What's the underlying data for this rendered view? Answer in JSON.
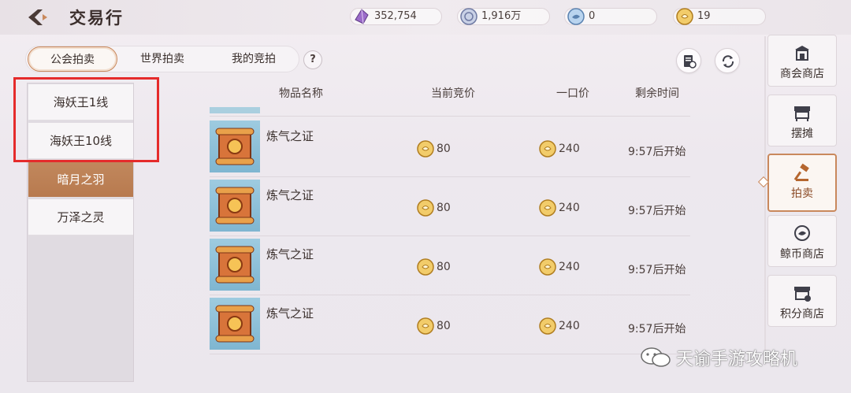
{
  "header": {
    "title": "交易行",
    "currencies": [
      {
        "icon": "purple-crystal-icon",
        "value": "352,754"
      },
      {
        "icon": "silver-coin-icon",
        "value": "1,916万"
      },
      {
        "icon": "whale-coin-icon",
        "value": "0"
      },
      {
        "icon": "gold-coin-icon",
        "value": "19"
      }
    ]
  },
  "tabs": [
    {
      "label": "公会拍卖",
      "active": true
    },
    {
      "label": "世界拍卖",
      "active": false
    },
    {
      "label": "我的竞拍",
      "active": false
    }
  ],
  "help_label": "?",
  "servers": [
    {
      "label": "海妖王1线",
      "active": false
    },
    {
      "label": "海妖王10线",
      "active": false
    },
    {
      "label": "暗月之羽",
      "active": true
    },
    {
      "label": "万泽之灵",
      "active": false
    }
  ],
  "columns": {
    "name": "物品名称",
    "bid": "当前竞价",
    "buyout": "一口价",
    "time": "剩余时间"
  },
  "items": [
    {
      "name": "炼气之证",
      "bid": "80",
      "buyout": "240",
      "time": "9:57后开始"
    },
    {
      "name": "炼气之证",
      "bid": "80",
      "buyout": "240",
      "time": "9:57后开始"
    },
    {
      "name": "炼气之证",
      "bid": "80",
      "buyout": "240",
      "time": "9:57后开始"
    },
    {
      "name": "炼气之证",
      "bid": "80",
      "buyout": "240",
      "time": "9:57后开始"
    }
  ],
  "sidebar": [
    {
      "label": "商会商店",
      "icon": "shop-icon",
      "active": false
    },
    {
      "label": "摆摊",
      "icon": "stall-icon",
      "active": false
    },
    {
      "label": "拍卖",
      "icon": "auction-hammer-icon",
      "active": true
    },
    {
      "label": "鲸币商店",
      "icon": "whale-coin-icon",
      "active": false
    },
    {
      "label": "积分商店",
      "icon": "points-shop-icon",
      "active": false
    }
  ],
  "watermark": "天谕手游攻略机"
}
